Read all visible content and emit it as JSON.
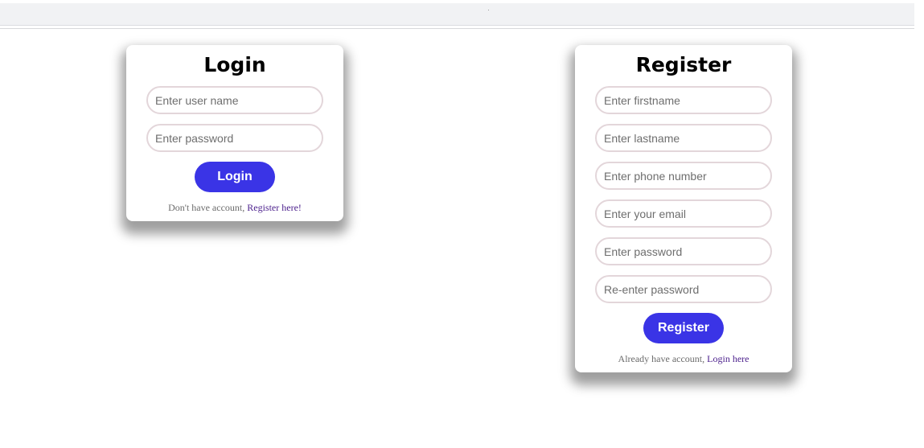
{
  "login": {
    "title": "Login",
    "username_placeholder": "Enter user name",
    "password_placeholder": "Enter password",
    "button_label": "Login",
    "footer_text": "Don't have account, ",
    "footer_link": "Register here!"
  },
  "register": {
    "title": "Register",
    "firstname_placeholder": "Enter firstname",
    "lastname_placeholder": "Enter lastname",
    "phone_placeholder": "Enter phone number",
    "email_placeholder": "Enter your email",
    "password_placeholder": "Enter password",
    "repassword_placeholder": "Re-enter password",
    "button_label": "Register",
    "footer_text": "Already have account, ",
    "footer_link": "Login here"
  },
  "colors": {
    "button": "#3a34e6",
    "field_border": "#e3d6da",
    "link": "#4b1f8c"
  }
}
